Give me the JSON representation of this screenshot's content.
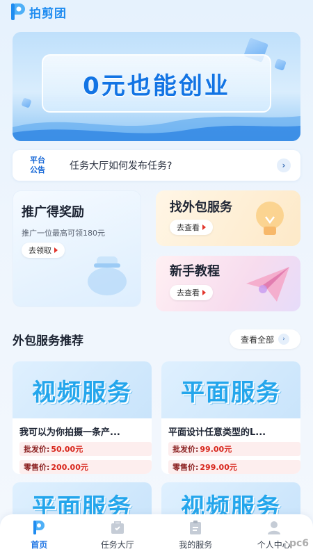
{
  "app": {
    "logo_text": "拍剪团"
  },
  "banner": {
    "title": "0元也能创业"
  },
  "notice": {
    "tag_line1": "平台",
    "tag_line2": "公告",
    "text": "任务大厅如何发布任务?",
    "arrow": "›"
  },
  "cards": {
    "promo": {
      "title": "推广得奖励",
      "subtitle": "推广一位最高可领180元",
      "button": "去领取"
    },
    "outsource": {
      "title": "找外包服务",
      "button": "去查看"
    },
    "tutorial": {
      "title": "新手教程",
      "button": "去查看"
    }
  },
  "section": {
    "title": "外包服务推荐",
    "view_all": "查看全部",
    "view_all_icon": "›"
  },
  "services": [
    {
      "image_text": "视频服务",
      "title": "我可以为你拍摄一条产...",
      "wholesale_label": "批发价:",
      "wholesale_price": "50.00元",
      "retail_label": "零售价:",
      "retail_price": "200.00元"
    },
    {
      "image_text": "平面服务",
      "title": "平面设计任意类型的L...",
      "wholesale_label": "批发价:",
      "wholesale_price": "99.00元",
      "retail_label": "零售价:",
      "retail_price": "299.00元"
    }
  ],
  "services_row2": [
    {
      "image_text": "平面服务"
    },
    {
      "image_text": "视频服务"
    }
  ],
  "tabbar": {
    "items": [
      {
        "label": "首页",
        "icon": "home-logo-icon",
        "active": true
      },
      {
        "label": "任务大厅",
        "icon": "task-hall-icon"
      },
      {
        "label": "我的服务",
        "icon": "my-service-icon"
      },
      {
        "label": "个人中心",
        "icon": "profile-icon"
      }
    ]
  },
  "watermark": {
    "text": "pc6"
  },
  "colors": {
    "accent": "#1d74e4",
    "price_red": "#d8261c",
    "button_arrow": "#e2352b"
  }
}
